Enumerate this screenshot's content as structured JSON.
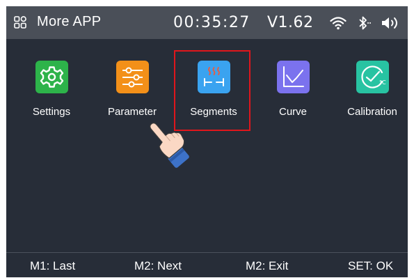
{
  "statusbar": {
    "title": "More APP",
    "time": "00:35:27",
    "version": "V1.62",
    "icons": [
      "app-grid-icon",
      "wifi-icon",
      "bluetooth-icon",
      "volume-icon"
    ]
  },
  "apps": [
    {
      "label": "Settings",
      "icon": "gear-icon",
      "color": "#2db34a"
    },
    {
      "label": "Parameter",
      "icon": "sliders-icon",
      "color": "#f39019"
    },
    {
      "label": "Segments",
      "icon": "heat-segments-icon",
      "color": "#3aa3f0"
    },
    {
      "label": "Curve",
      "icon": "line-chart-icon",
      "color": "#7b72ee"
    },
    {
      "label": "Calibration",
      "icon": "gauge-celsius-icon",
      "color": "#28c3a2"
    }
  ],
  "selected_app": "Segments",
  "highlight_color": "#e0161c",
  "footer": {
    "m1": "M1: Last",
    "m2_next": "M2: Next",
    "m2_exit": "M2: Exit",
    "set": "SET: OK"
  }
}
